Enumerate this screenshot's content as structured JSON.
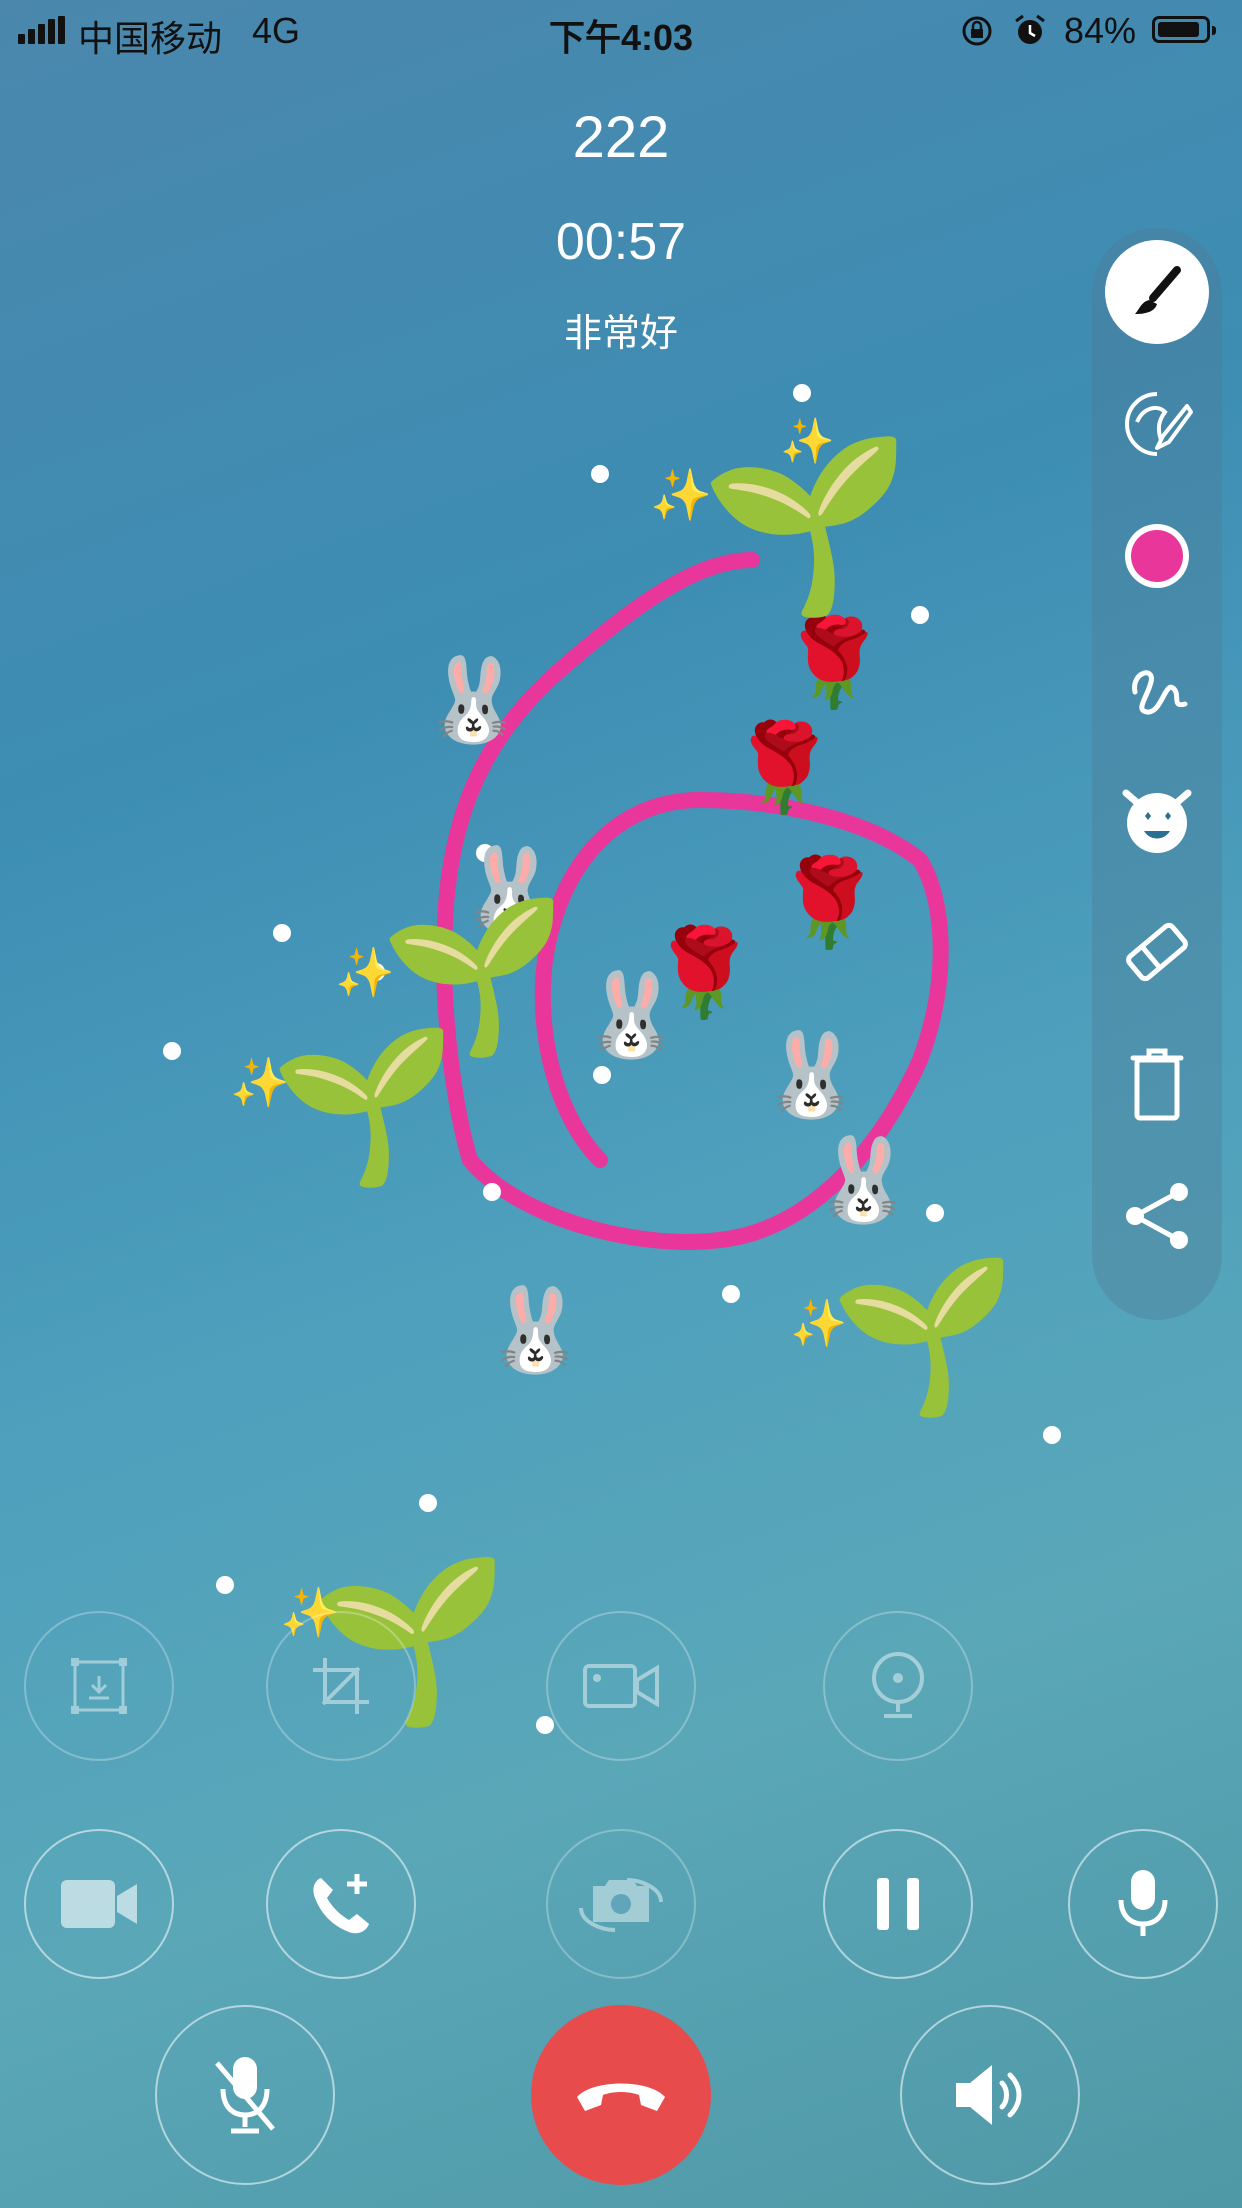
{
  "status_bar": {
    "carrier": "中国移动",
    "network": "4G",
    "time": "下午4:03",
    "battery": "84%"
  },
  "call": {
    "name": "222",
    "duration": "00:57",
    "quality": "非常好"
  },
  "toolbar": {
    "brush_color": "#e8369b",
    "tools": [
      "brush-icon",
      "face-beauty-icon",
      "color-dot-icon",
      "scribble-icon",
      "emoji-face-icon",
      "eraser-icon",
      "trash-icon",
      "share-icon"
    ]
  },
  "stickers": {
    "bunny": "🐰",
    "rose": "🌹",
    "sprout": "🌱",
    "sparkle": "✨"
  },
  "controls": {
    "row1": [
      "screenshot-icon",
      "crop-icon",
      "video-record-icon",
      "webcam-icon"
    ],
    "row2": [
      "video-icon",
      "add-call-icon",
      "switch-camera-icon",
      "pause-icon",
      "microphone-icon"
    ],
    "row3": [
      "mute-icon",
      "hangup-icon",
      "speaker-icon"
    ]
  },
  "colors": {
    "accent_pink": "#e8369b",
    "hangup_red": "#e84b4b"
  }
}
